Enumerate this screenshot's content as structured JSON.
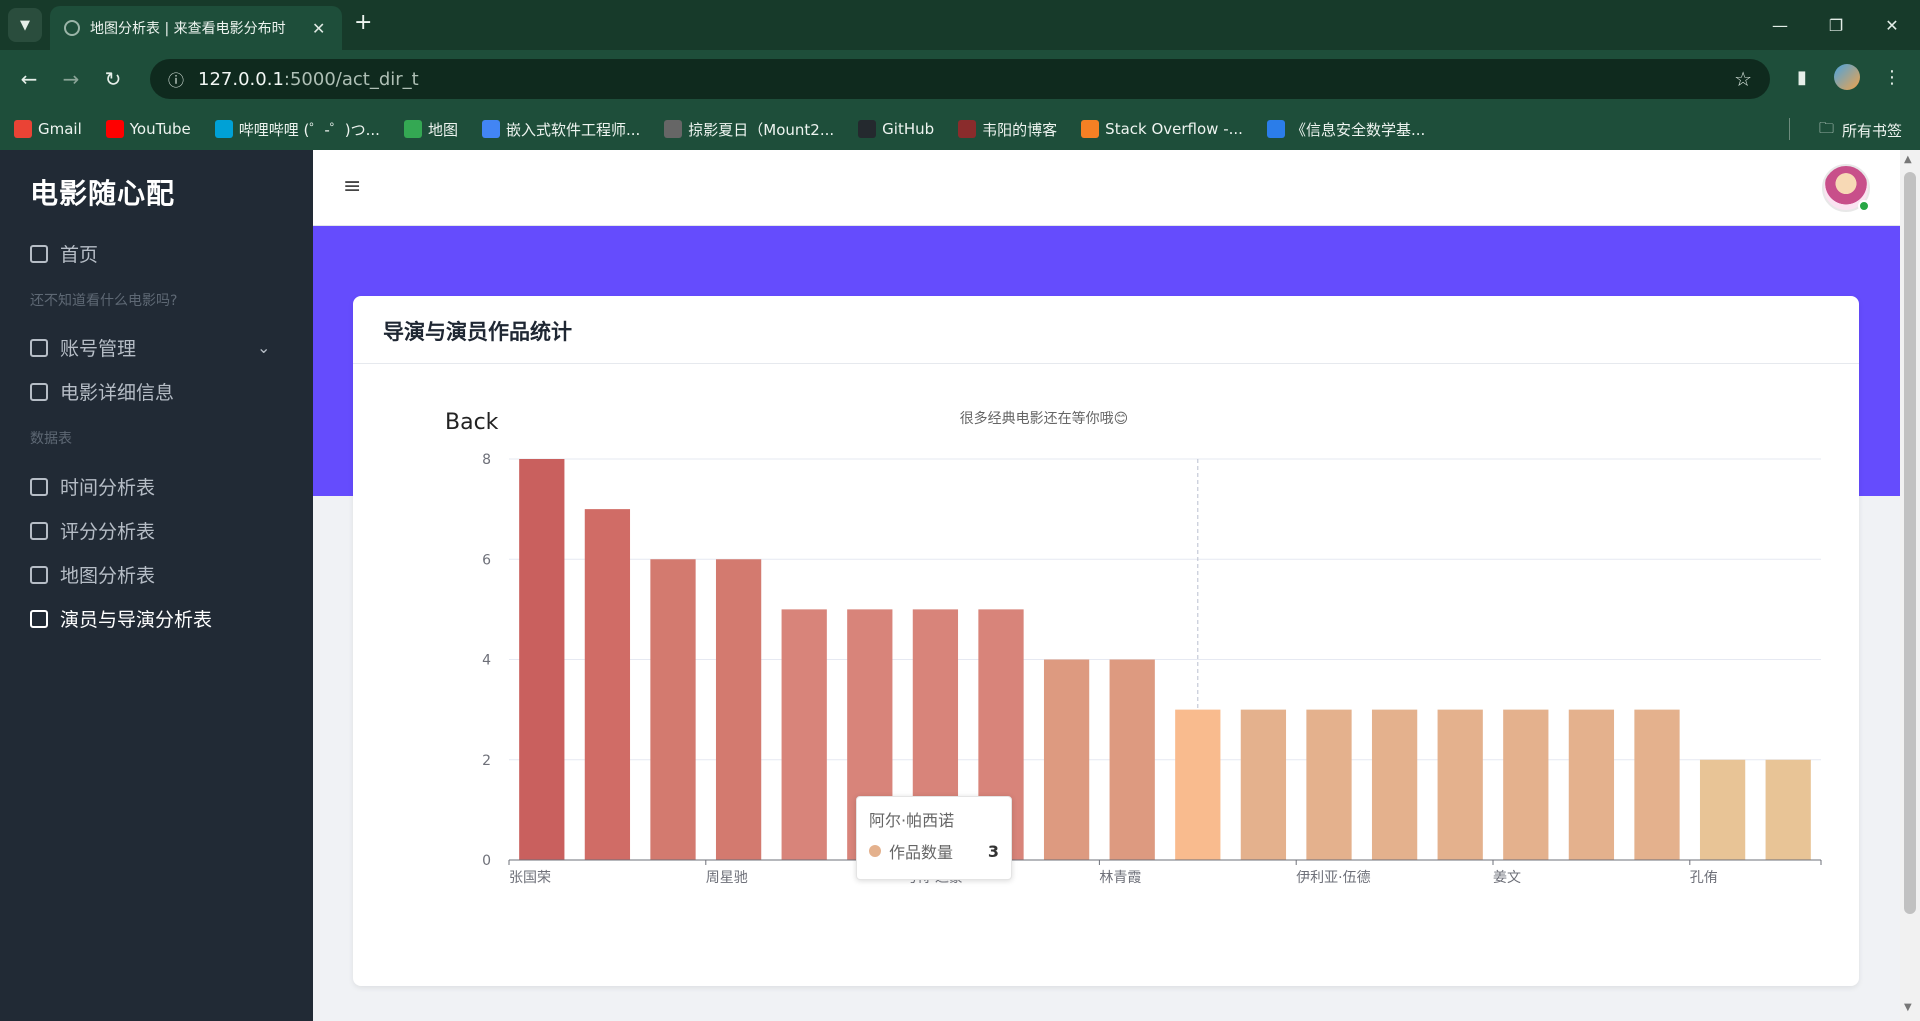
{
  "browser": {
    "tab_title": "地图分析表 | 来查看电影分布时",
    "url_host": "127.0.0.1",
    "url_rest": ":5000/act_dir_t",
    "bookmarks": [
      {
        "label": "Gmail",
        "color": "#ea4335"
      },
      {
        "label": "YouTube",
        "color": "#ff0000"
      },
      {
        "label": "哔哩哔哩 (゜-゜)つ...",
        "color": "#00a1d6"
      },
      {
        "label": "地图",
        "color": "#34a853"
      },
      {
        "label": "嵌入式软件工程师...",
        "color": "#4285f4"
      },
      {
        "label": "掠影夏日（Mount2...",
        "color": "#666666"
      },
      {
        "label": "GitHub",
        "color": "#24292e"
      },
      {
        "label": "韦阳的博客",
        "color": "#8a2c2c"
      },
      {
        "label": "Stack Overflow -...",
        "color": "#f48024"
      },
      {
        "label": "《信息安全数学基...",
        "color": "#2b7de9"
      }
    ],
    "all_bookmarks": "所有书签"
  },
  "sidebar": {
    "brand": "电影随心配",
    "home": "首页",
    "section1": "还不知道看什么电影吗?",
    "account": "账号管理",
    "movie_detail": "电影详细信息",
    "section2": "数据表",
    "time_analysis": "时间分析表",
    "score_analysis": "评分分析表",
    "map_analysis": "地图分析表",
    "actor_director": "演员与导演分析表"
  },
  "card": {
    "title": "导演与演员作品统计"
  },
  "chart_data": {
    "type": "bar",
    "title": "很多经典电影还在等你哦😊",
    "back_label": "Back",
    "ylim": [
      0,
      8
    ],
    "yticks": [
      0,
      2,
      4,
      6,
      8
    ],
    "series": [
      {
        "name": "作品数量",
        "values": [
          8,
          7,
          6,
          6,
          5,
          5,
          5,
          5,
          4,
          4,
          3,
          3,
          3,
          3,
          3,
          3,
          3,
          3,
          2,
          2
        ]
      }
    ],
    "visible_xtick_labels": [
      {
        "index": 0,
        "label": "张国荣"
      },
      {
        "index": 3,
        "label": "周星驰"
      },
      {
        "index": 6,
        "label": "马特·达蒙"
      },
      {
        "index": 9,
        "label": "林青霞"
      },
      {
        "index": 12,
        "label": "伊利亚·伍德"
      },
      {
        "index": 15,
        "label": "姜文"
      },
      {
        "index": 18,
        "label": "孔侑"
      }
    ],
    "colors": [
      "#c9605e",
      "#d06c66",
      "#d37a6f",
      "#d37a6f",
      "#d8847a",
      "#d8847a",
      "#d8847a",
      "#d8847a",
      "#dd9a80",
      "#dd9a80",
      "#f9bb8e",
      "#e4b18d",
      "#e4b18d",
      "#e4b18d",
      "#e4b18d",
      "#e4b18d",
      "#e4b18d",
      "#e4b18d",
      "#e8c496",
      "#e8c496"
    ],
    "grid": true,
    "tooltip": {
      "name": "阿尔·帕西诺",
      "series": "作品数量",
      "value": "3"
    }
  }
}
